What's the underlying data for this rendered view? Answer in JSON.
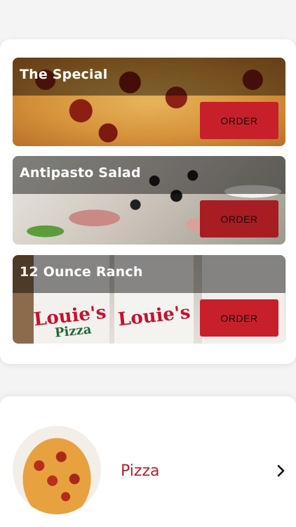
{
  "promos": [
    {
      "title": "The Special",
      "button": "ORDER",
      "button_color": "#c8202a"
    },
    {
      "title": "Antipasto Salad",
      "button": "ORDER",
      "button_color": "#a81d22"
    },
    {
      "title": "12 Ounce Ranch",
      "button": "ORDER",
      "button_color": "#c8202a"
    }
  ],
  "cup_text": {
    "brand": "Louie's",
    "sub": "Pizza"
  },
  "category": {
    "label": "Pizza",
    "chevron_icon": "chevron-right-icon"
  }
}
